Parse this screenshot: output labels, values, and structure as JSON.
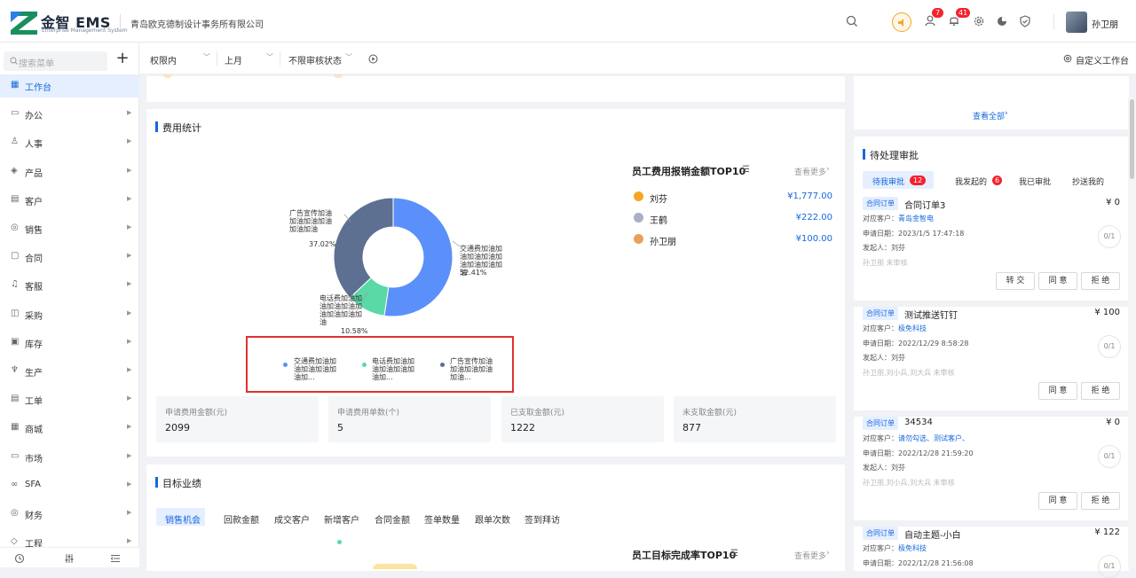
{
  "header": {
    "brand": "金智 EMS",
    "brand_sub": "Enterprise Management System",
    "company": "青岛欧克德制设计事务所有限公司",
    "notif_badge_1": "7",
    "notif_badge_2": "41",
    "username": "孙卫朋"
  },
  "sidebar": {
    "search_placeholder": "搜索菜单",
    "items": [
      {
        "label": "工作台",
        "active": true
      },
      {
        "label": "办公"
      },
      {
        "label": "人事"
      },
      {
        "label": "产品"
      },
      {
        "label": "客户"
      },
      {
        "label": "销售"
      },
      {
        "label": "合同"
      },
      {
        "label": "客服"
      },
      {
        "label": "采购"
      },
      {
        "label": "库存"
      },
      {
        "label": "生产"
      },
      {
        "label": "工单"
      },
      {
        "label": "商城"
      },
      {
        "label": "市场"
      },
      {
        "label": "SFA"
      },
      {
        "label": "财务"
      },
      {
        "label": "工程"
      }
    ]
  },
  "filters": {
    "scope": "权限内",
    "period": "上月",
    "status": "不限审核状态",
    "custom_workspace": "自定义工作台"
  },
  "expense": {
    "title": "费用统计",
    "labels": [
      {
        "text": "交通费加油加油加油加油加油加油加油加油",
        "pct": "52.41%"
      },
      {
        "text": "电话费加油加油加油加油加油加油加油加油",
        "pct": "10.58%"
      },
      {
        "text": "广告宣传加油加油加油加油加油加油",
        "pct": "37.02%"
      }
    ],
    "legend": [
      "交通费加油加油加油加油加油加...",
      "电话费加油加油加油加油加油加...",
      "广告宣传加油加油加油加油加油..."
    ],
    "stats": [
      {
        "label": "申请费用金额(元)",
        "value": "2099"
      },
      {
        "label": "申请费用单数(个)",
        "value": "5"
      },
      {
        "label": "已支取金额(元)",
        "value": "1222"
      },
      {
        "label": "未支取金额(元)",
        "value": "877"
      }
    ],
    "ranking": {
      "title": "员工费用报销金额TOP10",
      "more": "查看更多",
      "rows": [
        {
          "name": "刘芬",
          "value": "¥1,777.00"
        },
        {
          "name": "王鹤",
          "value": "¥222.00"
        },
        {
          "name": "孙卫朋",
          "value": "¥100.00"
        }
      ]
    }
  },
  "chart_data": {
    "type": "pie",
    "categories": [
      "交通费加油加油加油加油加油加油加油加油",
      "电话费加油加油加油加油加油加油加油加油",
      "广告宣传加油加油加油加油加油加油"
    ],
    "values": [
      52.41,
      10.58,
      37.02
    ],
    "colors": [
      "#5b8ff9",
      "#5ad8a6",
      "#5d7092"
    ]
  },
  "target": {
    "title": "目标业绩",
    "tabs": [
      "销售机会",
      "回款金额",
      "成交客户",
      "新增客户",
      "合同金额",
      "签单数量",
      "跟单次数",
      "签到拜访"
    ],
    "ranking_title": "员工目标完成率TOP10",
    "more": "查看更多"
  },
  "right": {
    "view_all": "查看全部",
    "approval_title": "待处理审批",
    "tabs": [
      {
        "label": "待我审批",
        "badge": "12"
      },
      {
        "label": "我发起的",
        "badge": "6"
      },
      {
        "label": "我已审批"
      },
      {
        "label": "抄送我的"
      }
    ],
    "items": [
      {
        "tag": "合同订单",
        "title": "合同订单3",
        "amount": "¥ 0",
        "customer_label": "对应客户：",
        "customer": "青岛金智电",
        "date": "申请日期：2023/1/5 17:47:18",
        "initiator": "发起人：刘芬",
        "note": "孙卫朋 未审核",
        "progress": "0/1",
        "buttons": [
          "转 交",
          "同 意",
          "拒 绝"
        ]
      },
      {
        "tag": "合同订单",
        "title": "测试推送钉钉",
        "amount": "¥ 100",
        "customer_label": "对应客户：",
        "customer": "极免科技",
        "date": "申请日期：2022/12/29 8:58:28",
        "initiator": "发起人：刘芬",
        "note": "孙卫朋,刘小兵,刘大兵 未审核",
        "progress": "0/1",
        "buttons": [
          "同 意",
          "拒 绝"
        ]
      },
      {
        "tag": "合同订单",
        "title": "34534",
        "amount": "¥ 0",
        "customer_label": "对应客户：",
        "customer": "请勿勾选、测试客户、",
        "date": "申请日期：2022/12/28 21:59:20",
        "initiator": "发起人：刘芬",
        "note": "孙卫朋,刘小兵,刘大兵 未审核",
        "progress": "0/1",
        "buttons": [
          "同 意",
          "拒 绝"
        ]
      },
      {
        "tag": "合同订单",
        "title": "自动主题-小白",
        "amount": "¥ 122",
        "customer_label": "对应客户：",
        "customer": "极免科技",
        "date": "申请日期：2022/12/28 21:56:08",
        "progress": "0/1"
      }
    ]
  }
}
